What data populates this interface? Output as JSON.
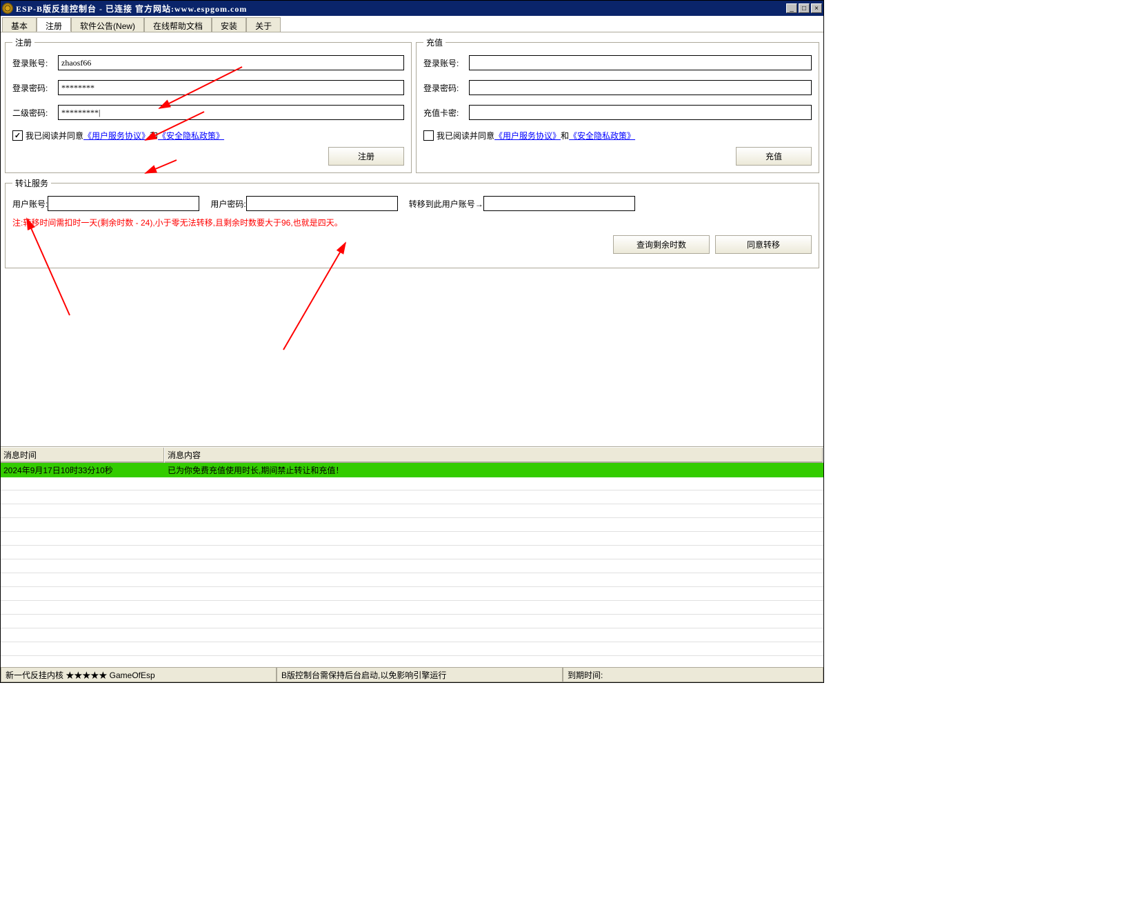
{
  "titlebar": {
    "title": "ESP-B版反挂控制台 - 已连接    官方网站:www.espgom.com"
  },
  "tabs": [
    "基本",
    "注册",
    "软件公告(New)",
    "在线帮助文档",
    "安装",
    "关于"
  ],
  "register": {
    "legend": "注册",
    "account_label": "登录账号:",
    "account_value": "zhaosf66",
    "password_label": "登录密码:",
    "password_value": "********",
    "secondpw_label": "二级密码:",
    "secondpw_value": "*********|",
    "agree_prefix": "我已阅读并同意",
    "link1": "《用户服务协议》",
    "and": "和",
    "link2": "《安全隐私政策》",
    "button": "注册"
  },
  "recharge": {
    "legend": "充值",
    "account_label": "登录账号:",
    "account_value": "",
    "password_label": "登录密码:",
    "password_value": "",
    "card_label": "充值卡密:",
    "card_value": "",
    "agree_prefix": "我已阅读并同意",
    "link1": "《用户服务协议》",
    "and": "和",
    "link2": "《安全隐私政策》",
    "button": "充值"
  },
  "transfer": {
    "legend": "转让服务",
    "user_label": "用户账号:",
    "user_value": "",
    "pw_label": "用户密码:",
    "pw_value": "",
    "target_label": "转移到此用户账号→",
    "target_value": "",
    "note": "注:转移时间需扣时一天(剩余时数 - 24),小于零无法转移,且剩余时数要大于96,也就是四天。",
    "query_button": "查询剩余时数",
    "agree_button": "同意转移"
  },
  "messages": {
    "time_header": "消息时间",
    "content_header": "消息内容",
    "rows": [
      {
        "time": "2024年9月17日10时33分10秒",
        "content": "已为你免费充值使用时长,期间禁止转让和充值！"
      }
    ]
  },
  "statusbar": {
    "pane1": "新一代反挂内核 ★★★★★ GameOfEsp",
    "pane2": "B版控制台需保持后台启动,以免影响引擎运行",
    "pane3": "到期时间:"
  }
}
